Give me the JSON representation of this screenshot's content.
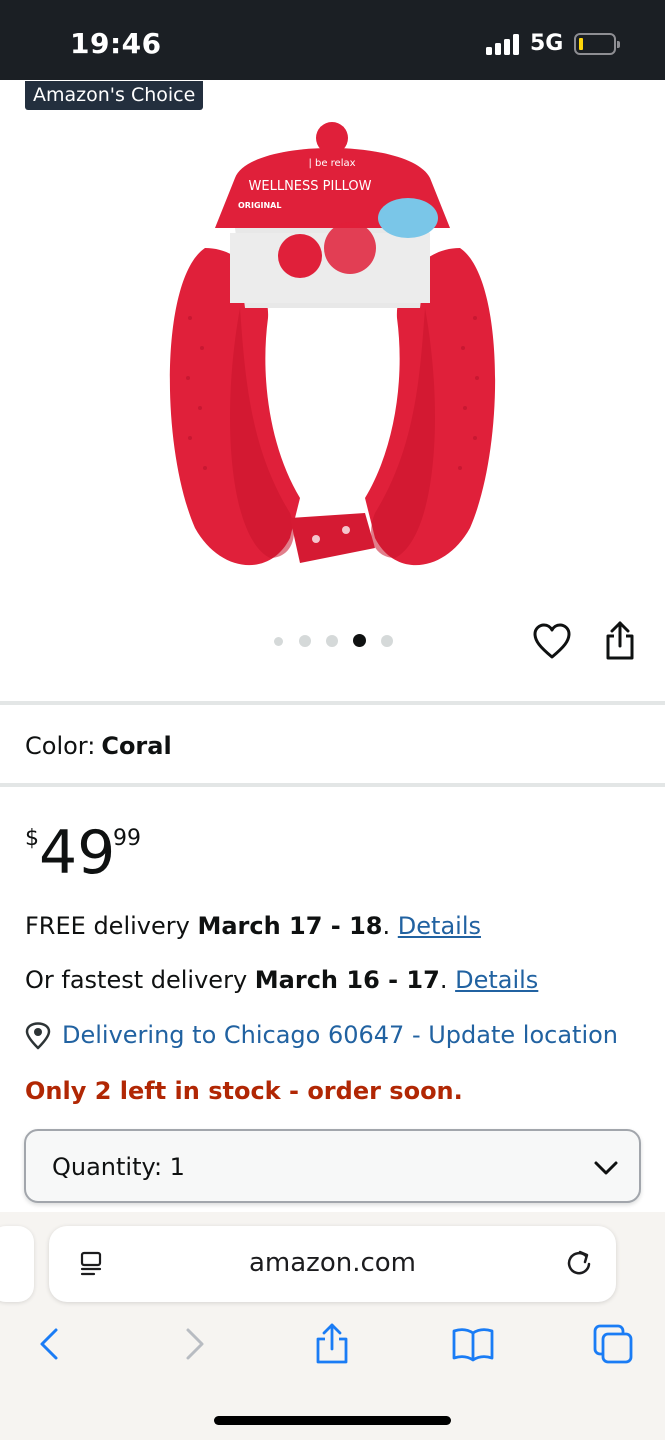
{
  "status_bar": {
    "time": "19:46",
    "network": "5G"
  },
  "product": {
    "badge": "Amazon's Choice",
    "image_icon": "product-photo-neck-pillow",
    "image_dots_count": 5,
    "image_dots_active_index": 3,
    "color_label": "Color:",
    "color_value": "Coral",
    "price": {
      "symbol": "$",
      "whole": "49",
      "fraction": "99"
    }
  },
  "delivery": {
    "free_prefix": "FREE delivery ",
    "free_dates": "March 17 - 18",
    "free_suffix": ". ",
    "free_link": "Details",
    "fast_prefix": "Or fastest delivery ",
    "fast_dates": "March 16 - 17",
    "fast_suffix": ". ",
    "fast_link": "Details",
    "location": "Delivering to Chicago 60647 - Update location"
  },
  "stock": "Only 2 left in stock - order soon.",
  "quantity": {
    "label": "Quantity: 1"
  },
  "browser": {
    "url": "amazon.com"
  },
  "colors": {
    "status_bar_bg": "#1b1f24",
    "link": "#2162a1",
    "stock_red": "#b12704",
    "safari_blue": "#1a7cf5",
    "pillow_red": "#e0203a"
  }
}
